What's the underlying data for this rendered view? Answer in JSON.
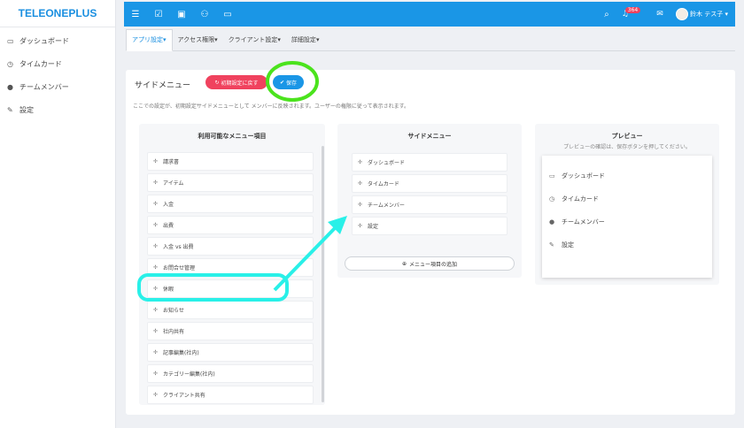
{
  "logo": "TELEONEPLUS",
  "sidebar": {
    "items": [
      {
        "label": "ダッシュボード",
        "icon": "monitor-icon"
      },
      {
        "label": "タイムカード",
        "icon": "clock-icon"
      },
      {
        "label": "チームメンバー",
        "icon": "user-icon"
      },
      {
        "label": "設定",
        "icon": "wrench-icon"
      }
    ]
  },
  "topbar": {
    "notification_count": "364",
    "user_name": "鈴木 テス子"
  },
  "tabs": [
    {
      "label": "アプリ設定"
    },
    {
      "label": "アクセス権限"
    },
    {
      "label": "クライアント設定"
    },
    {
      "label": "詳細設定"
    }
  ],
  "section": {
    "title": "サイドメニュー",
    "reset_label": "初期設定に戻す",
    "save_label": "保存",
    "description": "ここでの設定が、初期設定サイドメニューとして メンバーに反映されます。ユーザーの権限に従って表示されます。"
  },
  "available": {
    "title": "利用可能なメニュー項目",
    "items": [
      "請求書",
      "アイテム",
      "入金",
      "出費",
      "入金 vs 出費",
      "お問合せ管理",
      "休暇",
      "お知らせ",
      "社内共有",
      "記事編集(社内)",
      "カテゴリー編集(社内)",
      "クライアント共有"
    ]
  },
  "sidemenu": {
    "title": "サイドメニュー",
    "items": [
      "ダッシュボード",
      "タイムカード",
      "チームメンバー",
      "設定"
    ],
    "add_label": "メニュー項目の追加"
  },
  "preview": {
    "title": "プレビュー",
    "subtitle": "プレビューの確認は、保存ボタンを押してください。",
    "items": [
      {
        "label": "ダッシュボード",
        "icon": "monitor-icon"
      },
      {
        "label": "タイムカード",
        "icon": "clock-icon"
      },
      {
        "label": "チームメンバー",
        "icon": "user-icon"
      },
      {
        "label": "設定",
        "icon": "wrench-icon"
      }
    ]
  },
  "colors": {
    "accent": "#1a96e6",
    "danger": "#f0425e",
    "highlight_green": "#4be31d",
    "highlight_cyan": "#29f0e8"
  }
}
